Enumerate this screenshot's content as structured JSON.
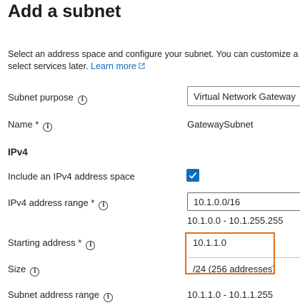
{
  "page": {
    "title": "Add a subnet",
    "description_line1": "Select an address space and configure your subnet. You can customize a",
    "description_line2": "select services later.",
    "learn_more": "Learn more"
  },
  "form": {
    "subnet_purpose_label": "Subnet purpose",
    "subnet_purpose_value": "Virtual Network Gateway",
    "name_label": "Name *",
    "name_value": "GatewaySubnet",
    "ipv4_section": "IPv4",
    "include_ipv4_label": "Include an IPv4 address space",
    "include_ipv4_checked": true,
    "ipv4_range_label": "IPv4 address range *",
    "ipv4_range_value": "10.1.0.0/16",
    "ipv4_range_hint": "10.1.0.0 - 10.1.255.255",
    "starting_address_label": "Starting address *",
    "starting_address_value": "10.1.1.0",
    "size_label": "Size",
    "size_value": "/24 (256 addresses)",
    "subnet_range_label": "Subnet address range",
    "subnet_range_value": "10.1.1.0 - 10.1.1.255"
  },
  "icons": {
    "info": "info-icon",
    "external": "external-link-icon",
    "check": "checkmark-icon"
  },
  "colors": {
    "accent": "#0f6cbd",
    "highlight": "#e07020"
  }
}
